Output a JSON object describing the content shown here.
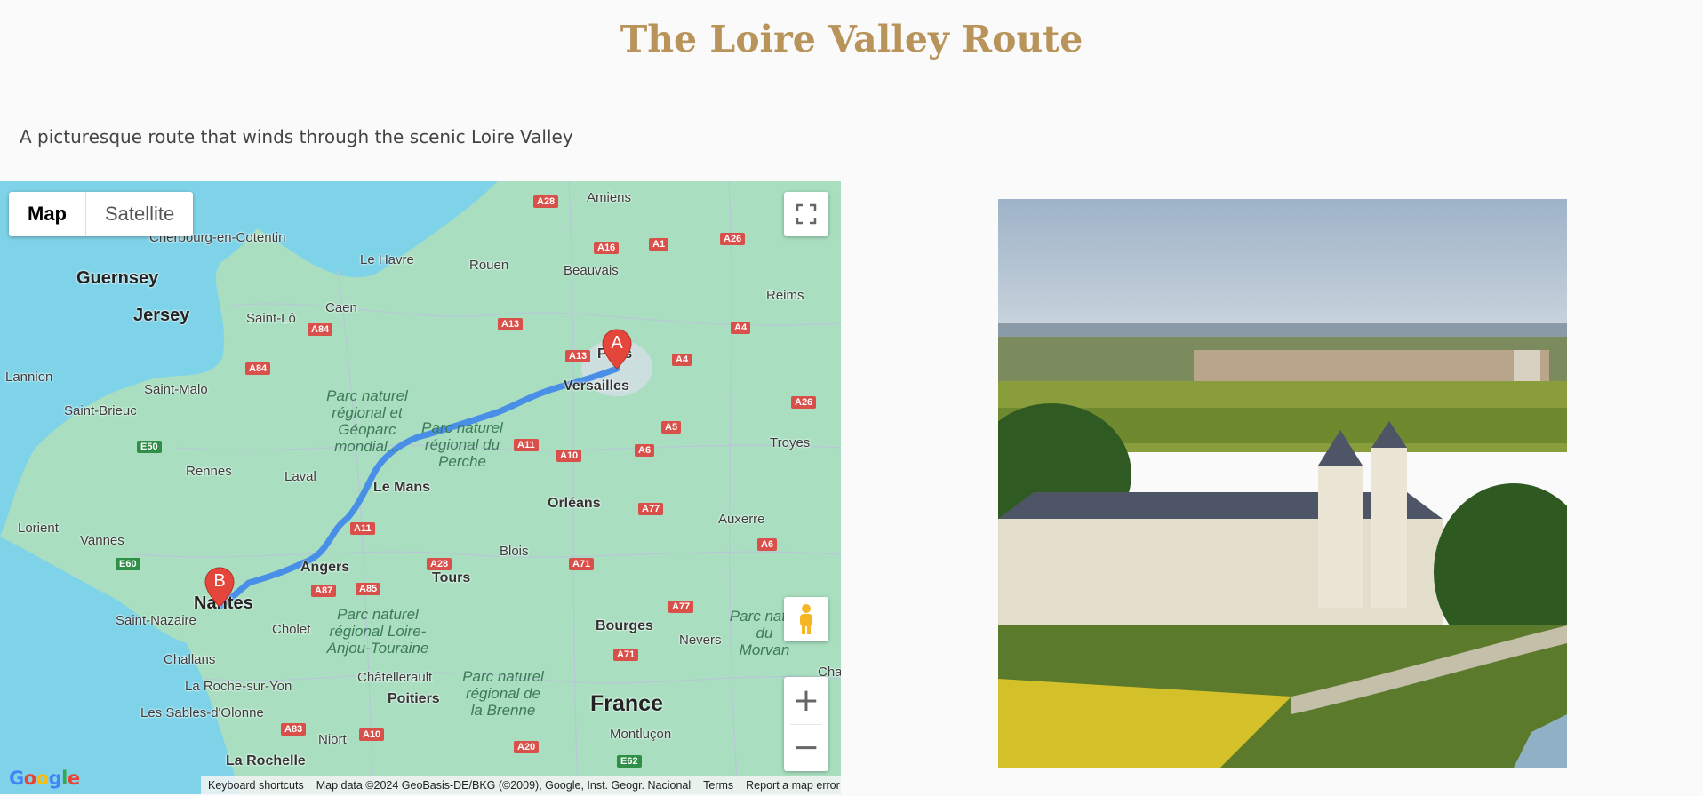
{
  "page": {
    "title": "The Loire Valley Route",
    "description": "A picturesque route that winds through the scenic Loire Valley"
  },
  "map": {
    "type_buttons": [
      "Map",
      "Satellite"
    ],
    "active_type": "Map",
    "start_marker": "A",
    "end_marker": "B",
    "country_label": "France",
    "city_labels": [
      "Cherbourg-en-Cotentin",
      "Guernsey",
      "Jersey",
      "Le Havre",
      "Rouen",
      "Beauvais",
      "Amiens",
      "Reims",
      "Caen",
      "Saint-Lô",
      "Paris",
      "Versailles",
      "Lannion",
      "Saint-Malo",
      "Saint-Brieuc",
      "Rennes",
      "Laval",
      "Le Mans",
      "Orléans",
      "Troyes",
      "Auxerre",
      "Lorient",
      "Vannes",
      "Angers",
      "Tours",
      "Blois",
      "Nantes",
      "Saint-Nazaire",
      "Cholet",
      "Bourges",
      "Nevers",
      "Challans",
      "La Roche-sur-Yon",
      "Châtellerault",
      "Poitiers",
      "Les Sables-d'Olonne",
      "Niort",
      "Montluçon",
      "La Rochelle",
      "Cha"
    ],
    "park_labels": [
      "Parc naturel régional et Géoparc mondial...",
      "Parc naturel régional du Perche",
      "Parc naturel régional Loire-Anjou-Touraine",
      "Parc naturel régional de la Brenne",
      "Parc natur du Morvan"
    ],
    "road_shields": [
      "A28",
      "A16",
      "A1",
      "A26",
      "A13",
      "A84",
      "A4",
      "A84",
      "A13",
      "A4",
      "A26",
      "A11",
      "A10",
      "A6",
      "A5",
      "A11",
      "A77",
      "A28",
      "A71",
      "A87",
      "A85",
      "A6",
      "A77",
      "A71",
      "A83",
      "A10",
      "A20",
      "E62"
    ],
    "green_shields": [
      "E50",
      "E60"
    ],
    "logo_text": "Google",
    "attribution": {
      "shortcuts": "Keyboard shortcuts",
      "data": "Map data ©2024 GeoBasis-DE/BKG (©2009), Google, Inst. Geogr. Nacional",
      "terms": "Terms",
      "report": "Report a map error"
    },
    "controls": {
      "fullscreen_icon": "fullscreen-icon",
      "pegman_icon": "pegman-icon",
      "zoom_in": "+",
      "zoom_out": "−"
    },
    "colors": {
      "water": "#7fd3e8",
      "land": "#a9dfc0",
      "route": "#4a8fe7",
      "marker": "#e5463b"
    }
  },
  "photo": {
    "alt": "Loire Valley chateau with vineyards and river"
  },
  "colors": {
    "title": "#b8935a",
    "text": "#444444",
    "background": "#fafafa"
  }
}
